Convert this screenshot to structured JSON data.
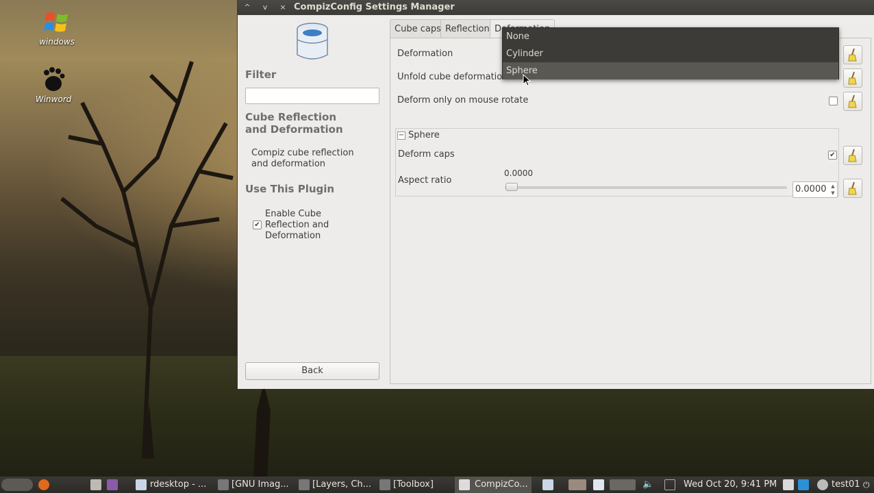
{
  "desktop": {
    "icons": [
      {
        "label": "windows"
      },
      {
        "label": "Winword"
      }
    ]
  },
  "window": {
    "title": "CompizConfig Settings Manager",
    "controls": {
      "minimize": "^",
      "maximize": "v",
      "close": "×"
    }
  },
  "left_pane": {
    "filter_heading": "Filter",
    "filter_value": "",
    "plugin_heading_line1": "Cube Reflection",
    "plugin_heading_line2": "and Deformation",
    "plugin_desc_line1": "Compiz cube reflection",
    "plugin_desc_line2": "and deformation",
    "use_heading": "Use This Plugin",
    "enable_line1": "Enable Cube",
    "enable_line2": "Reflection and",
    "enable_line3": "Deformation",
    "enable_checked": true,
    "back_label": "Back"
  },
  "tabs": [
    {
      "label": "Cube caps"
    },
    {
      "label": "Reflection"
    },
    {
      "label": "Deformation",
      "active": true
    }
  ],
  "settings": {
    "deformation_label": "Deformation",
    "unfold_label": "Unfold cube deformation",
    "deform_mouse_label": "Deform only on mouse rotate",
    "deform_mouse_checked": false,
    "sphere_group_label": "Sphere",
    "sphere_group_toggle": "−",
    "deform_caps_label": "Deform caps",
    "deform_caps_checked": true,
    "aspect_label": "Aspect ratio",
    "aspect_value_display": "0.0000",
    "aspect_spin_value": "0.0000",
    "aspect_slider_fraction": 0.0
  },
  "dropdown": {
    "options": [
      "None",
      "Cylinder",
      "Sphere"
    ],
    "highlighted": "Sphere"
  },
  "taskbar": {
    "items": [
      {
        "label": "rdesktop - ..."
      },
      {
        "label": "[GNU Imag..."
      },
      {
        "label": "[Layers, Ch..."
      },
      {
        "label": "[Toolbox]"
      },
      {
        "label": "CompizCo...",
        "active": true
      }
    ],
    "clock": "Wed Oct 20,  9:41 PM",
    "user": "test01"
  },
  "colors": {
    "titlebar": "#3c3b37",
    "window_bg": "#edeceb",
    "dropdown_bg": "#3c3b37",
    "dropdown_hover": "#5a5853",
    "taskbar": "#2b2a27"
  }
}
